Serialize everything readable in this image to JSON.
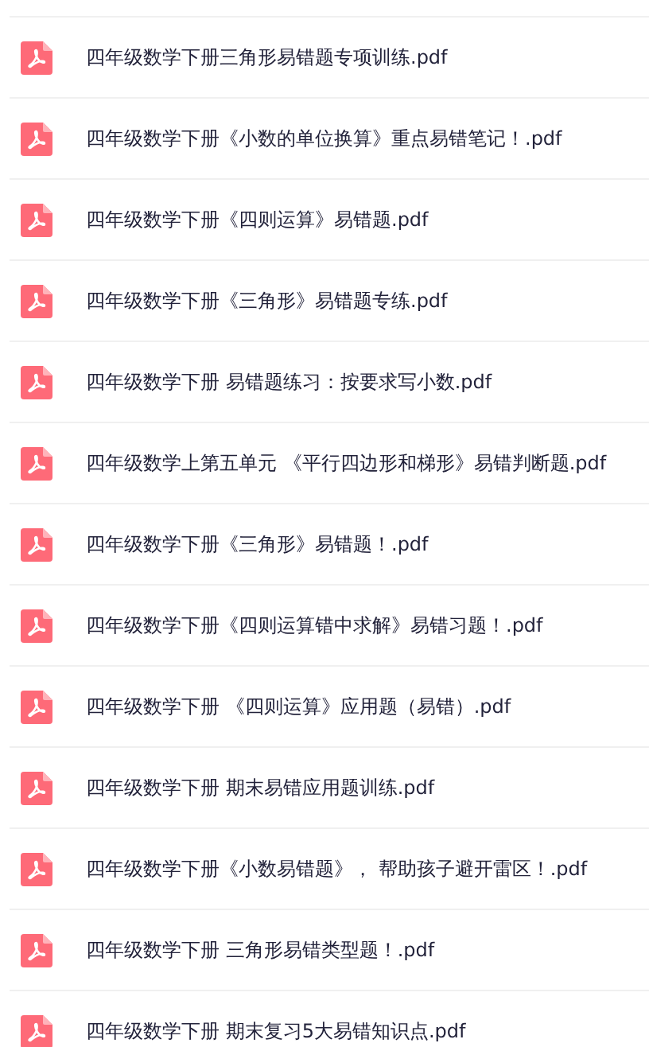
{
  "files": [
    {
      "name": "四年级数学下册三角形易错题专项训练.pdf"
    },
    {
      "name": "四年级数学下册《小数的单位换算》重点易错笔记！.pdf"
    },
    {
      "name": "四年级数学下册《四则运算》易错题.pdf"
    },
    {
      "name": "四年级数学下册《三角形》易错题专练.pdf"
    },
    {
      "name": "四年级数学下册 易错题练习：按要求写小数.pdf"
    },
    {
      "name": "四年级数学上第五单元 《平行四边形和梯形》易错判断题.pdf"
    },
    {
      "name": "四年级数学下册《三角形》易错题！.pdf"
    },
    {
      "name": "四年级数学下册《四则运算错中求解》易错习题！.pdf"
    },
    {
      "name": "四年级数学下册 《四则运算》应用题（易错）.pdf"
    },
    {
      "name": "四年级数学下册 期末易错应用题训练.pdf"
    },
    {
      "name": "四年级数学下册《小数易错题》， 帮助孩子避开雷区！.pdf"
    },
    {
      "name": "四年级数学下册 三角形易错类型题！.pdf"
    },
    {
      "name": "四年级数学下册 期末复习5大易错知识点.pdf"
    }
  ]
}
